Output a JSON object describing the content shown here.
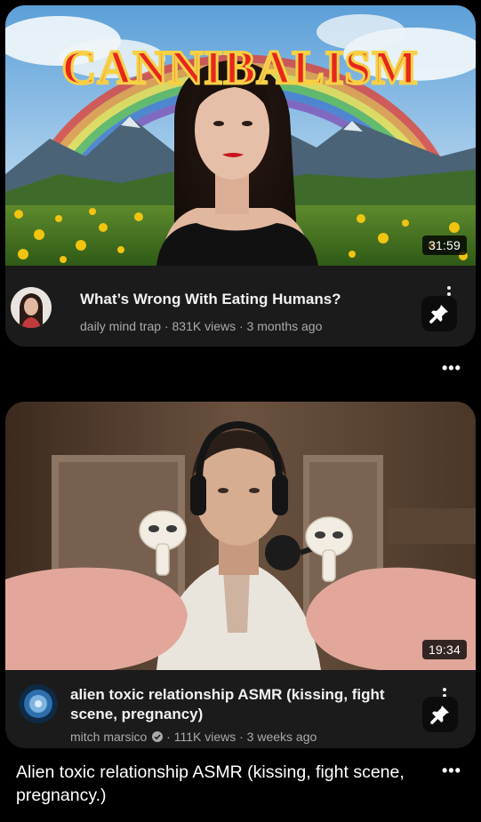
{
  "posts": [
    {
      "video": {
        "thumbnail_text": "CANNIBALISM",
        "duration": "31:59",
        "title": "What’s Wrong With Eating Humans?",
        "channel": "daily mind trap",
        "views": "831K views",
        "age": "3 months ago",
        "separator": "·"
      }
    },
    {
      "video": {
        "duration": "19:34",
        "title": "alien toxic relationship ASMR (kissing, fight scene, pregnancy)",
        "channel": "mitch marsico",
        "verified": true,
        "views": "111K views",
        "age": "3 weeks ago",
        "separator": "·"
      },
      "caption": "Alien toxic relationship ASMR (kissing, fight scene, pregnancy.)"
    }
  ],
  "icons": {
    "more": "more-horizontal-icon",
    "kebab": "more-vertical-icon",
    "pin": "pushpin-icon",
    "verified": "verified-check-icon"
  },
  "colors": {
    "background": "#000000",
    "card": "#1b1b1b",
    "meta_text": "#aaaaaa",
    "thumbnail_title_red": "#e8261c",
    "thumbnail_title_outline": "#f6d046"
  }
}
